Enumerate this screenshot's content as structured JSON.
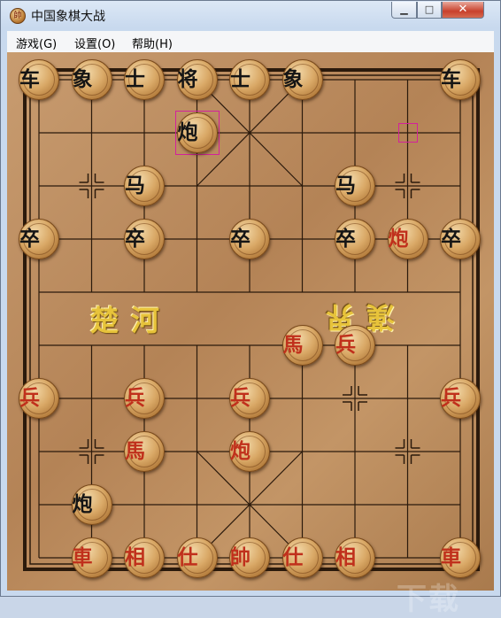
{
  "window": {
    "title": "中国象棋大战",
    "icon_name": "xiangqi-app-icon",
    "icon_glyph": "帥"
  },
  "menu": [
    {
      "label": "游戏(G)"
    },
    {
      "label": "设置(O)"
    },
    {
      "label": "帮助(H)"
    }
  ],
  "board": {
    "river_left": "楚河",
    "river_right": "漢界",
    "files": 9,
    "ranks": 10
  },
  "pieces": [
    {
      "label": "车",
      "side": "black",
      "col": 0,
      "row": 0
    },
    {
      "label": "象",
      "side": "black",
      "col": 1,
      "row": 0
    },
    {
      "label": "士",
      "side": "black",
      "col": 2,
      "row": 0
    },
    {
      "label": "将",
      "side": "black",
      "col": 3,
      "row": 0
    },
    {
      "label": "士",
      "side": "black",
      "col": 4,
      "row": 0
    },
    {
      "label": "象",
      "side": "black",
      "col": 5,
      "row": 0
    },
    {
      "label": "车",
      "side": "black",
      "col": 8,
      "row": 0
    },
    {
      "label": "炮",
      "side": "black",
      "col": 3,
      "row": 1
    },
    {
      "label": "马",
      "side": "black",
      "col": 2,
      "row": 2
    },
    {
      "label": "马",
      "side": "black",
      "col": 6,
      "row": 2
    },
    {
      "label": "卒",
      "side": "black",
      "col": 0,
      "row": 3
    },
    {
      "label": "卒",
      "side": "black",
      "col": 2,
      "row": 3
    },
    {
      "label": "卒",
      "side": "black",
      "col": 4,
      "row": 3
    },
    {
      "label": "卒",
      "side": "black",
      "col": 6,
      "row": 3
    },
    {
      "label": "炮",
      "side": "red",
      "col": 7,
      "row": 3
    },
    {
      "label": "卒",
      "side": "black",
      "col": 8,
      "row": 3
    },
    {
      "label": "馬",
      "side": "red",
      "col": 5,
      "row": 5
    },
    {
      "label": "兵",
      "side": "red",
      "col": 6,
      "row": 5
    },
    {
      "label": "兵",
      "side": "red",
      "col": 0,
      "row": 6
    },
    {
      "label": "兵",
      "side": "red",
      "col": 2,
      "row": 6
    },
    {
      "label": "兵",
      "side": "red",
      "col": 4,
      "row": 6
    },
    {
      "label": "兵",
      "side": "red",
      "col": 8,
      "row": 6
    },
    {
      "label": "馬",
      "side": "red",
      "col": 2,
      "row": 7
    },
    {
      "label": "炮",
      "side": "red",
      "col": 4,
      "row": 7
    },
    {
      "label": "炮",
      "side": "black",
      "col": 1,
      "row": 8
    },
    {
      "label": "車",
      "side": "red",
      "col": 1,
      "row": 9
    },
    {
      "label": "相",
      "side": "red",
      "col": 2,
      "row": 9
    },
    {
      "label": "仕",
      "side": "red",
      "col": 3,
      "row": 9
    },
    {
      "label": "帥",
      "side": "red",
      "col": 4,
      "row": 9
    },
    {
      "label": "仕",
      "side": "red",
      "col": 5,
      "row": 9
    },
    {
      "label": "相",
      "side": "red",
      "col": 6,
      "row": 9
    },
    {
      "label": "車",
      "side": "red",
      "col": 8,
      "row": 9
    }
  ],
  "highlights": [
    {
      "kind": "selected-piece",
      "col": 3,
      "row": 1
    },
    {
      "kind": "move-origin",
      "col": 7,
      "row": 1
    }
  ],
  "colors": {
    "red_piece": "#c0301c",
    "black_piece": "#151515",
    "highlight": "#d3219c",
    "river_text": "#e7c33b"
  }
}
